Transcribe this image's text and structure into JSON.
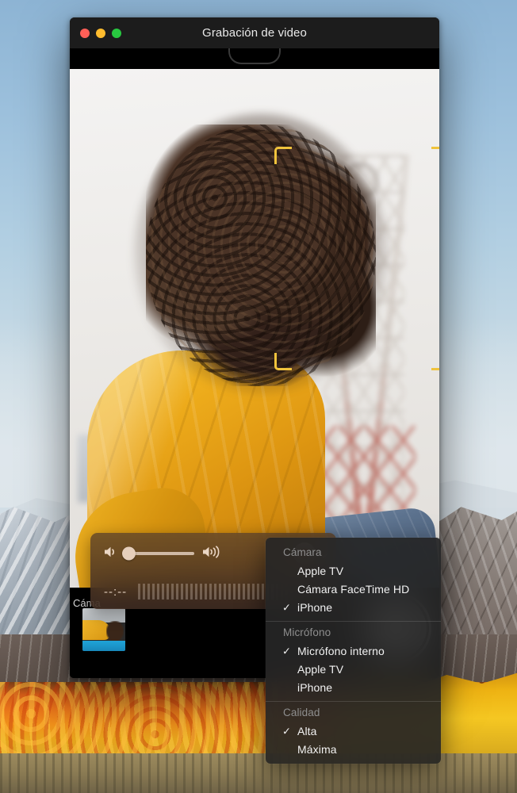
{
  "window": {
    "title": "Grabación de video",
    "traffic_lights": [
      {
        "name": "close",
        "color": "#ff5f57"
      },
      {
        "name": "minimize",
        "color": "#febc2e"
      },
      {
        "name": "maximize",
        "color": "#28c840"
      }
    ]
  },
  "controls": {
    "volume_low_icon": "speaker-low-icon",
    "volume_high_icon": "speaker-high-icon",
    "volume_value": 0,
    "record_icon": "record-dot-icon",
    "options_icon": "chevron-down-icon",
    "time_display": "--:--",
    "level_meter_label": "audio-level-meter"
  },
  "overlay": {
    "peek_label": "Cáma"
  },
  "bottom_bar": {
    "thumbnail_label": "last-capture-thumbnail",
    "shutter_label": "shutter-button"
  },
  "menu": {
    "sections": [
      {
        "heading": "Cámara",
        "items": [
          {
            "label": "Apple TV",
            "checked": false
          },
          {
            "label": "Cámara FaceTime HD",
            "checked": false
          },
          {
            "label": "iPhone",
            "checked": true
          }
        ]
      },
      {
        "heading": "Micrófono",
        "items": [
          {
            "label": "Micrófono interno",
            "checked": true
          },
          {
            "label": "Apple TV",
            "checked": false
          },
          {
            "label": "iPhone",
            "checked": false
          }
        ]
      },
      {
        "heading": "Calidad",
        "items": [
          {
            "label": "Alta",
            "checked": true
          },
          {
            "label": "Máxima",
            "checked": false
          }
        ]
      }
    ],
    "check_glyph": "✓"
  },
  "colors": {
    "record_red": "#f22f1e",
    "face_bracket_yellow": "#f0c33c",
    "menu_background": "#262626",
    "titlebar": "#1c1c1c"
  }
}
